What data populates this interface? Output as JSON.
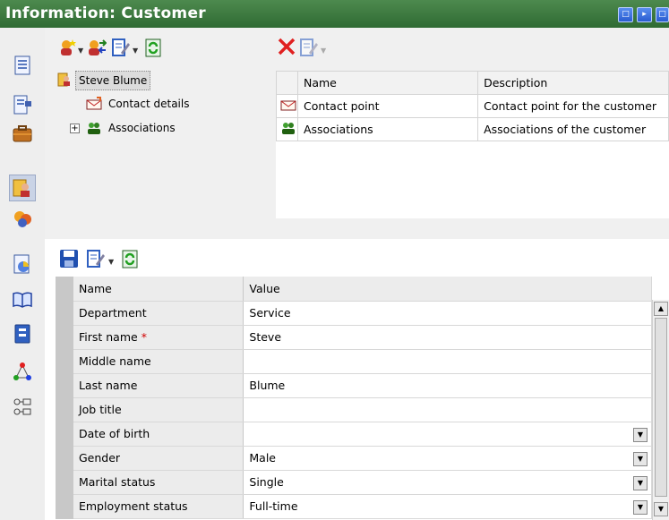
{
  "window": {
    "title": "Information: Customer"
  },
  "title_buttons": [
    "restore",
    "next",
    "close"
  ],
  "tree": {
    "root": "Steve Blume",
    "children": [
      {
        "label": "Contact details"
      },
      {
        "label": "Associations",
        "expand": "+"
      }
    ]
  },
  "relations_table": {
    "headers": [
      "Name",
      "Description"
    ],
    "rows": [
      {
        "name": "Contact point",
        "description": "Contact point for the customer"
      },
      {
        "name": "Associations",
        "description": "Associations of the customer"
      }
    ]
  },
  "properties": {
    "headers": [
      "Name",
      "Value"
    ],
    "rows": [
      {
        "name": "Department",
        "value": "Service"
      },
      {
        "name": "First name",
        "value": "Steve",
        "required": "*"
      },
      {
        "name": "Middle name",
        "value": ""
      },
      {
        "name": "Last name",
        "value": "Blume"
      },
      {
        "name": "Job title",
        "value": ""
      },
      {
        "name": "Date of birth",
        "value": ""
      },
      {
        "name": "Gender",
        "value": "Male"
      },
      {
        "name": "Marital status",
        "value": "Single"
      },
      {
        "name": "Employment status",
        "value": "Full-time"
      }
    ]
  },
  "colors": {
    "titlebar": "#2f6b33",
    "required": "#d00000",
    "delete": "#e02020"
  }
}
